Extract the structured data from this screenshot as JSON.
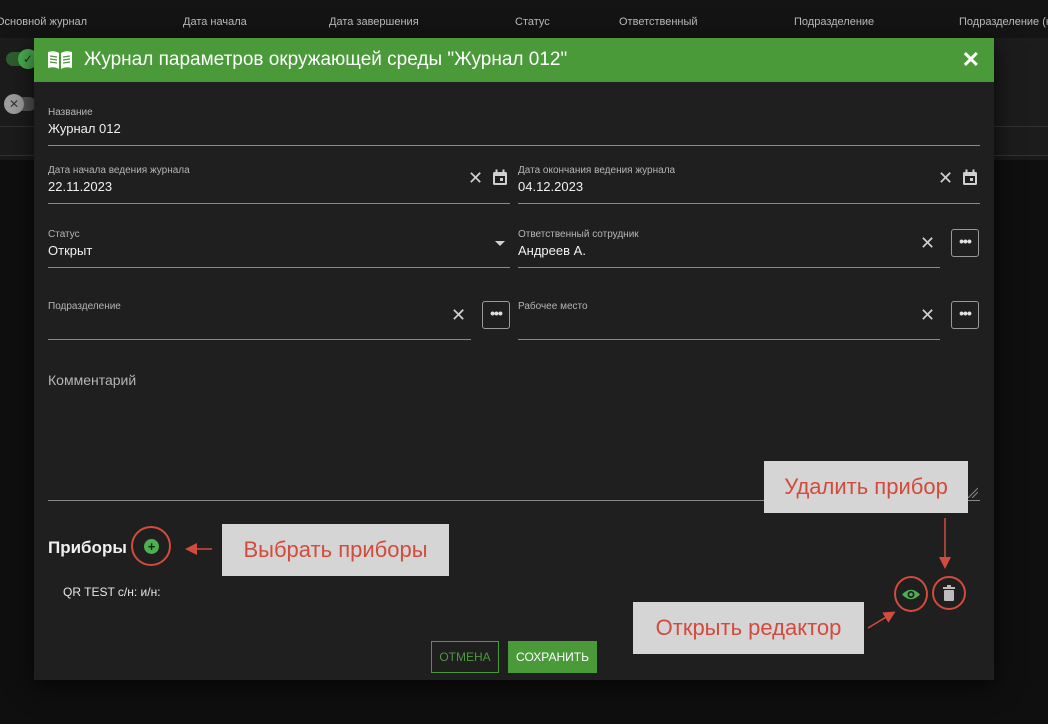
{
  "background_table": {
    "columns": [
      "Основной журнал",
      "Дата начала",
      "Дата завершения",
      "Статус",
      "Ответственный",
      "Подразделение",
      "Подразделение (к"
    ]
  },
  "dialog": {
    "title": "Журнал параметров окружающей среды \"Журнал 012\"",
    "icons": {
      "header": "book-icon",
      "close": "close-icon"
    },
    "fields": {
      "name": {
        "label": "Название",
        "value": "Журнал 012"
      },
      "start_date": {
        "label": "Дата начала ведения журнала",
        "value": "22.11.2023"
      },
      "end_date": {
        "label": "Дата окончания ведения журнала",
        "value": "04.12.2023"
      },
      "status": {
        "label": "Статус",
        "value": "Открыт"
      },
      "responsible": {
        "label": "Ответственный сотрудник",
        "value": "Андреев А."
      },
      "department": {
        "label": "Подразделение",
        "value": ""
      },
      "workplace": {
        "label": "Рабочее место",
        "value": ""
      },
      "comment": {
        "label": "Комментарий",
        "value": ""
      }
    },
    "devices": {
      "title": "Приборы",
      "items": [
        {
          "text": "QR TEST с/н: и/н:"
        }
      ]
    },
    "buttons": {
      "cancel": "ОТМЕНА",
      "save": "СОХРАНИТЬ"
    }
  },
  "annotations": {
    "select_devices": "Выбрать приборы",
    "delete_device": "Удалить прибор",
    "open_editor": "Открыть редактор",
    "color": "#d24b3c"
  },
  "colors": {
    "accent": "#4a9a3a",
    "dialog_bg": "#1f1f1f",
    "page_bg": "#0f0f0f"
  }
}
